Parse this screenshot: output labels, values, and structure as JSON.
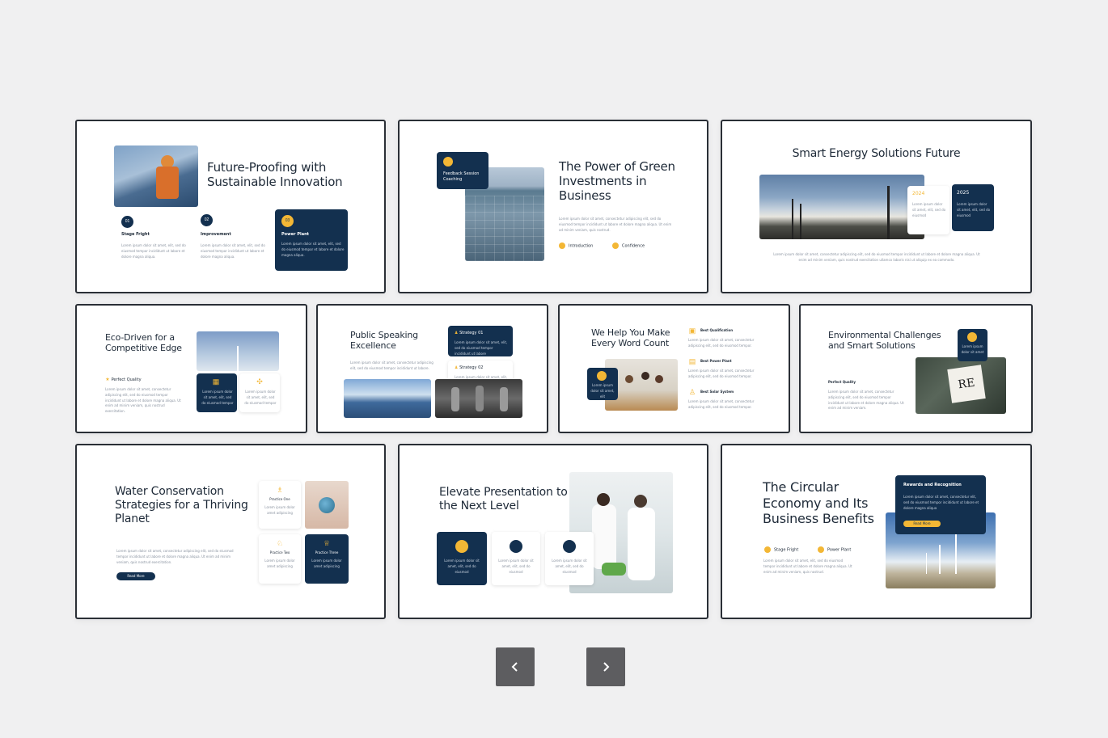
{
  "slides": [
    {
      "title": "Future-Proofing with Sustainable Innovation",
      "steps": [
        {
          "num": "01",
          "label": "Stage Fright",
          "text": "Lorem ipsum dolor sit amet, elit, sed do eiusmod tempor incididunt ut labore et dolore magna aliqua."
        },
        {
          "num": "02",
          "label": "Improvement",
          "text": "Lorem ipsum dolor sit amet, elit, sed do eiusmod tempor incididunt ut labore et dolore magna aliqua."
        },
        {
          "num": "03",
          "label": "Power Plant",
          "text": "Lorem ipsum dolor sit amet, elit, sed do eiusmod tempor et labore et dolore magna aliqua."
        }
      ]
    },
    {
      "title": "The Power of Green Investments in Business",
      "badge": "Feedback Session Coaching",
      "body": "Lorem ipsum dolor sit amet, consectetur adipiscing elit, sed do eiusmod tempor incididunt ut labore et dolore magna aliqua. Ut enim ad minim veniam, quis nostrud.",
      "checks": [
        "Introduction",
        "Confidence"
      ]
    },
    {
      "title": "Smart Energy Solutions Future",
      "years": [
        {
          "year": "2024",
          "text": "Lorem ipsum dolor sit amet, elit, sed do eiusmod"
        },
        {
          "year": "2025",
          "text": "Lorem ipsum dolor sit amet, elit, sed do eiusmod"
        }
      ],
      "body": "Lorem ipsum dolor sit amet, consectetur adipiscing elit, sed do eiusmod tempor incididunt ut labore et dolore magna aliqua. Ut enim ad minim veniam, quis nostrud exercitation ullamco laboris nisi ut aliquip ex ea commodo."
    },
    {
      "title": "Eco-Driven for a Competitive Edge",
      "label": "Perfect Quality",
      "body": "Lorem ipsum dolor sit amet, consectetur adipiscing elit, sed do eiusmod tempor incididunt ut labore et dolore magna aliqua. Ut enim ad minim veniam, quis nostrud exercitation.",
      "card1": "Lorem ipsum dolor sit amet, elit, sed do eiusmod tempor",
      "card2": "Lorem ipsum dolor sit amet, elit, sed do eiusmod tempor"
    },
    {
      "title": "Public Speaking Excellence",
      "body": "Lorem ipsum dolor sit amet, consectetur adipiscing elit, sed do eiusmod tempor incididunt ut labore.",
      "strategy1": "Strategy 01",
      "strategy1_text": "Lorem ipsum dolor sit amet, elit, sed do eiusmod tempor incididunt ut labore",
      "strategy2": "Strategy 02",
      "strategy2_text": "Lorem ipsum dolor sit amet, elit, sed do eiusmod tempor incididunt ut labore"
    },
    {
      "title": "We Help You Make Every Word Count",
      "badge": "Lorem ipsum dolor sit amet, elit",
      "items": [
        {
          "label": "Best Qualification",
          "text": "Lorem ipsum dolor sit amet, consectetur adipiscing elit, sed do eiusmod tempor."
        },
        {
          "label": "Best Power Plant",
          "text": "Lorem ipsum dolor sit amet, consectetur adipiscing elit, sed do eiusmod tempor."
        },
        {
          "label": "Best Solar System",
          "text": "Lorem ipsum dolor sit amet, consectetur adipiscing elit, sed do eiusmod tempor."
        }
      ]
    },
    {
      "title": "Environmental Challenges and Smart Solutions",
      "label": "Perfect Quality",
      "body": "Lorem ipsum dolor sit amet, consectetur adipiscing elit, sed do eiusmod tempor incididunt ut labore et dolore magna aliqua. Ut enim ad minim veniam.",
      "badge": "Lorem ipsum dolor sit amet"
    },
    {
      "title": "Water Conservation Strategies for a Thriving Planet",
      "body": "Lorem ipsum dolor sit amet, consectetur adipiscing elit, sed do eiusmod tempor incididunt ut labore et dolore magna aliqua. Ut enim ad minim veniam, quis nostrud exercitation.",
      "button": "Read More",
      "practices": [
        {
          "label": "Practice One",
          "text": "Lorem ipsum dolor amet adipiscing"
        },
        {
          "label": "Practice Two",
          "text": "Lorem ipsum dolor amet adipiscing"
        },
        {
          "label": "Practice Three",
          "text": "Lorem ipsum dolor amet adipiscing"
        }
      ]
    },
    {
      "title": "Elevate Presentation to the Next Level",
      "cards": [
        "Lorem ipsum dolor sit amet, elit, sed do eiusmod",
        "Lorem ipsum dolor sit amet, elit, sed do eiusmod",
        "Lorem ipsum dolor sit amet, elit, sed do eiusmod"
      ]
    },
    {
      "title": "The Circular Economy and Its Business Benefits",
      "card_title": "Rewards and Recognition",
      "card_text": "Lorem ipsum dolor sit amet, consectetur elit, sed do eiusmod tempor incididunt ut labore et dolore magna aliqua",
      "button": "Read More",
      "checks": [
        "Stage Fright",
        "Power Plant"
      ],
      "body": "Lorem ipsum dolor sit amet, elit, sed do eiusmod tempor incididunt ut labore et dolore magna aliqua. Ut enim ad minim veniam, quis nostrud."
    }
  ],
  "nav": {
    "prev": "‹",
    "next": "›"
  },
  "colors": {
    "navy": "#13304f",
    "accent": "#f3b735",
    "background": "#f0f0f1",
    "button": "#5d5d60"
  }
}
